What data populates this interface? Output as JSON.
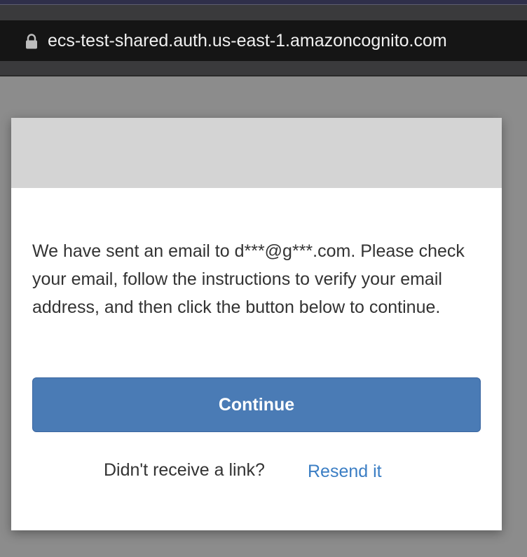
{
  "browser": {
    "url": "ecs-test-shared.auth.us-east-1.amazoncognito.com",
    "lock_icon": "lock-icon"
  },
  "dialog": {
    "message": "We have sent an email to d***@g***.com. Please check your email, follow the instructions to verify your email address, and then click the button below to continue.",
    "continue_label": "Continue",
    "resend_prompt": "Didn't receive a link?",
    "resend_label": "Resend it"
  },
  "colors": {
    "overlay": "#8c8c8c",
    "header": "#d4d4d4",
    "button": "#4a7bb5",
    "link": "#3b7ec4",
    "text": "#333333"
  }
}
